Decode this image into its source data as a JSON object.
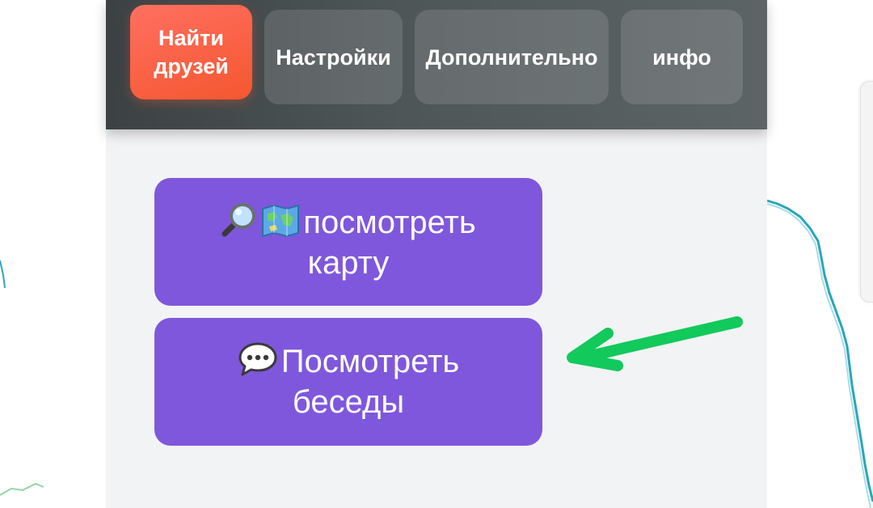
{
  "nav": {
    "tabs": [
      {
        "label": "Найти друзей",
        "active": true
      },
      {
        "label": "Настройки",
        "active": false
      },
      {
        "label": "Дополнительно",
        "active": false
      },
      {
        "label": "инфо",
        "active": false
      }
    ]
  },
  "actions": {
    "view_map": {
      "label": "посмотреть карту",
      "icons": [
        "magnifying-glass-icon",
        "world-map-icon"
      ]
    },
    "view_chats": {
      "label": "Посмотреть беседы",
      "icons": [
        "speech-bubble-icon"
      ]
    }
  },
  "colors": {
    "toolbar_bg": "#4a5052",
    "active_tab": "#f75c3c",
    "action_button": "#7f57dc",
    "annotation_arrow": "#12c95b",
    "panel_bg": "#f2f3f5"
  }
}
